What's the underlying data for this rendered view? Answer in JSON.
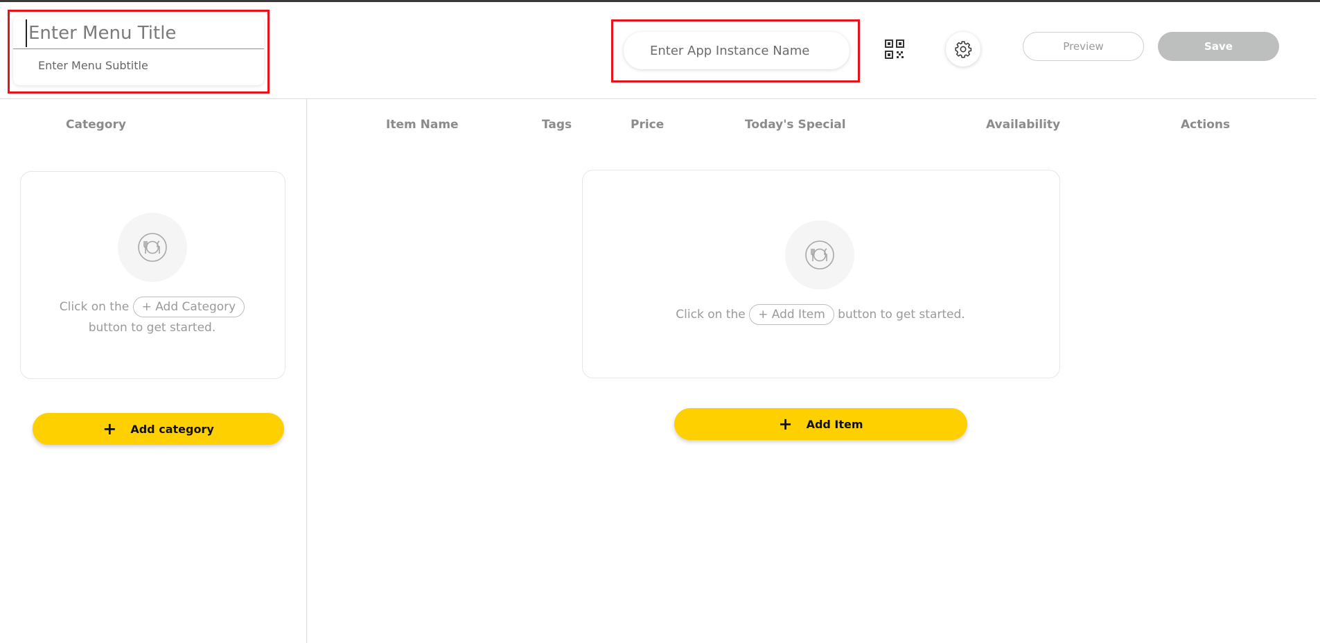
{
  "header": {
    "menu_title_placeholder": "Enter Menu Title",
    "menu_subtitle_placeholder": "Enter Menu Subtitle",
    "app_instance_placeholder": "Enter App Instance Name",
    "preview_label": "Preview",
    "save_label": "Save",
    "qr_icon": "qr-code-icon",
    "settings_icon": "gear-icon"
  },
  "category_panel": {
    "heading": "Category",
    "empty": {
      "prefix": "Click on the",
      "pill": "+ Add Category",
      "suffix": "button to get started."
    },
    "add_button_label": "Add category"
  },
  "items_panel": {
    "columns": [
      "Item Name",
      "Tags",
      "Price",
      "Today's Special",
      "Availability",
      "Actions"
    ],
    "empty": {
      "prefix": "Click on the",
      "pill": "+ Add Item",
      "suffix": "button to get started."
    },
    "add_button_label": "Add Item"
  },
  "colors": {
    "accent": "#ffd000",
    "highlight_box": "#e8121c",
    "save_disabled": "#bcbfbe"
  }
}
